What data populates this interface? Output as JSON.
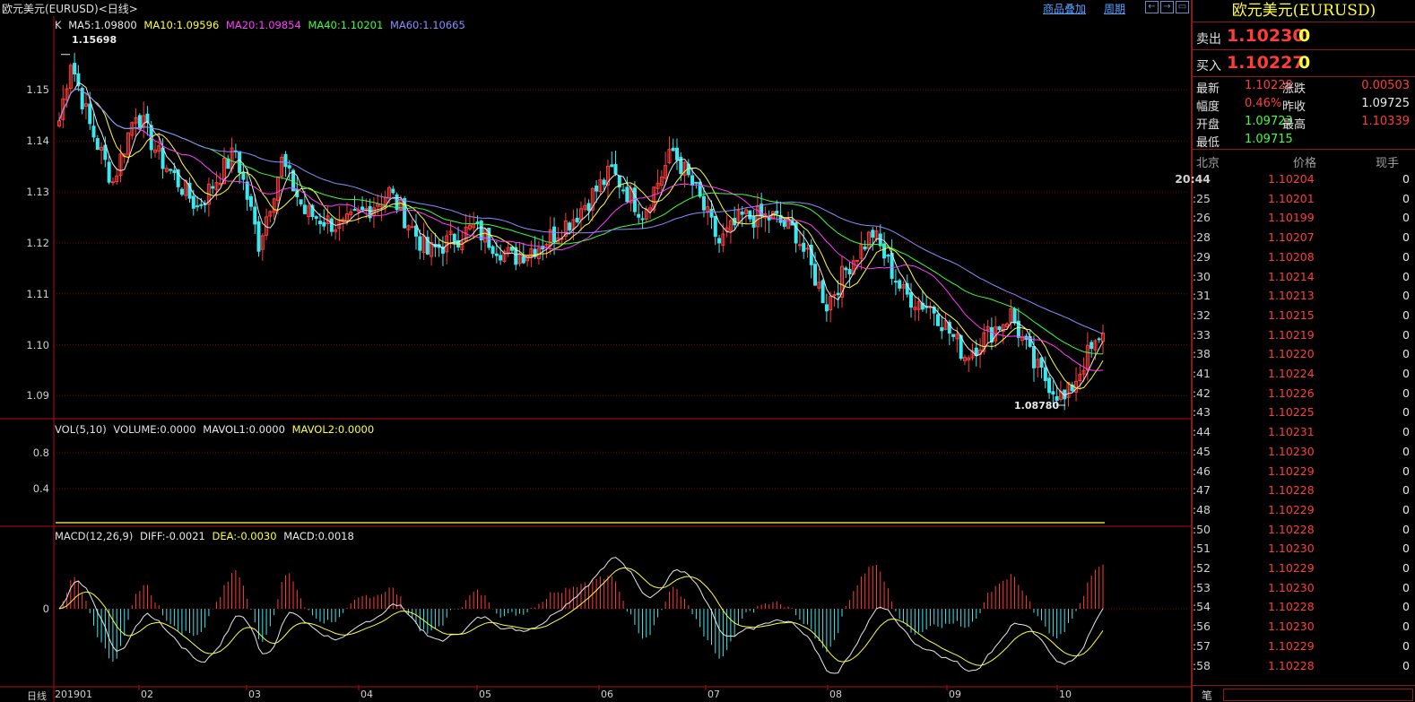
{
  "window": {
    "title": "欧元美元(EURUSD)<日线>",
    "overlay_link": "商品叠加",
    "period_link": "周期",
    "nav_buttons": [
      "←",
      "→",
      "▭"
    ]
  },
  "colors": {
    "up": "#ff3c3c",
    "down": "#3ce8f0",
    "ma5": "#e8e8e8",
    "ma10": "#ffff3c",
    "ma20": "#ff3cff",
    "ma40": "#3cff3c",
    "ma60": "#8c8cff",
    "grid": "#7a0000"
  },
  "price_legend": {
    "k": "K",
    "ma5": "MA5:1.09800",
    "ma10": "MA10:1.09596",
    "ma20": "MA20:1.09854",
    "ma40": "MA40:1.10201",
    "ma60": "MA60:1.10665"
  },
  "vol_legend": {
    "vol": "VOL(5,10)",
    "volume": "VOLUME:0.0000",
    "mavol1": "MAVOL1:0.0000",
    "mavol2": "MAVOL2:0.0000"
  },
  "macd_legend": {
    "macd": "MACD(12,26,9)",
    "diff": "DIFF:-0.0021",
    "dea": "DEA:-0.0030",
    "value": "MACD:0.0018"
  },
  "annotations": {
    "high": "1.15698",
    "low": "1.08780"
  },
  "chart_data": {
    "type": "candlestick",
    "price_axis": {
      "ticks": [
        "1.15",
        "1.14",
        "1.13",
        "1.12",
        "1.11",
        "1.10",
        "1.09"
      ],
      "range": [
        1.0855,
        1.1645
      ]
    },
    "volume_axis": {
      "ticks": [
        "0.8",
        "0.4"
      ]
    },
    "macd_axis": {
      "ticks": [
        "0"
      ]
    },
    "period_label": "日线",
    "x_tick_labels": [
      "201901",
      "02",
      "03",
      "04",
      "05",
      "06",
      "07",
      "08",
      "09",
      "10"
    ],
    "high": 1.15698,
    "low": 1.0878,
    "last_close": 1.10228
  },
  "quote": {
    "title": "欧元美元(EURUSD)",
    "sell_label": "卖出",
    "sell_price": "1.10230",
    "sell_vol": "0",
    "buy_label": "买入",
    "buy_price": "1.10227",
    "buy_vol": "0",
    "stats": [
      {
        "label": "最新",
        "value": "1.10228",
        "color": "#ff3c3c"
      },
      {
        "label": "涨跌",
        "value": "0.00503",
        "color": "#ff3c3c"
      },
      {
        "label": "幅度",
        "value": "0.46%",
        "color": "#ff3c3c"
      },
      {
        "label": "昨收",
        "value": "1.09725",
        "color": "#e8e8e8"
      },
      {
        "label": "开盘",
        "value": "1.09723",
        "color": "#3cff3c"
      },
      {
        "label": "最高",
        "value": "1.10339",
        "color": "#ff3c3c"
      },
      {
        "label": "最低",
        "value": "1.09715",
        "color": "#3cff3c"
      }
    ],
    "ticks_header": {
      "time": "北京",
      "price": "价格",
      "vol": "现手"
    },
    "ticks": [
      {
        "t": "20:44",
        "p": "1.10204",
        "v": "0"
      },
      {
        "t": ":25",
        "p": "1.10201",
        "v": "0"
      },
      {
        "t": ":26",
        "p": "1.10199",
        "v": "0"
      },
      {
        "t": ":28",
        "p": "1.10207",
        "v": "0"
      },
      {
        "t": ":29",
        "p": "1.10208",
        "v": "0"
      },
      {
        "t": ":30",
        "p": "1.10214",
        "v": "0"
      },
      {
        "t": ":31",
        "p": "1.10213",
        "v": "0"
      },
      {
        "t": ":32",
        "p": "1.10215",
        "v": "0"
      },
      {
        "t": ":33",
        "p": "1.10219",
        "v": "0"
      },
      {
        "t": ":38",
        "p": "1.10220",
        "v": "0"
      },
      {
        "t": ":41",
        "p": "1.10224",
        "v": "0"
      },
      {
        "t": ":42",
        "p": "1.10226",
        "v": "0"
      },
      {
        "t": ":43",
        "p": "1.10225",
        "v": "0"
      },
      {
        "t": ":44",
        "p": "1.10231",
        "v": "0"
      },
      {
        "t": ":45",
        "p": "1.10230",
        "v": "0"
      },
      {
        "t": ":46",
        "p": "1.10229",
        "v": "0"
      },
      {
        "t": ":47",
        "p": "1.10228",
        "v": "0"
      },
      {
        "t": ":48",
        "p": "1.10229",
        "v": "0"
      },
      {
        "t": ":50",
        "p": "1.10228",
        "v": "0"
      },
      {
        "t": ":51",
        "p": "1.10230",
        "v": "0"
      },
      {
        "t": ":52",
        "p": "1.10229",
        "v": "0"
      },
      {
        "t": ":53",
        "p": "1.10230",
        "v": "0"
      },
      {
        "t": ":54",
        "p": "1.10228",
        "v": "0"
      },
      {
        "t": ":56",
        "p": "1.10230",
        "v": "0"
      },
      {
        "t": ":57",
        "p": "1.10229",
        "v": "0"
      },
      {
        "t": ":58",
        "p": "1.10228",
        "v": "0"
      }
    ],
    "bottom_label": "笔"
  }
}
